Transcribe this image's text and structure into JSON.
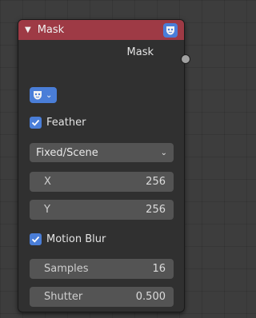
{
  "node": {
    "title": "Mask",
    "header_color": "#9e3a45",
    "header_icon": "mask-icon",
    "output": {
      "label": "Mask"
    },
    "mask_selector": {
      "icon": "mask-icon"
    },
    "feather": {
      "label": "Feather",
      "checked": true
    },
    "size_mode": {
      "value": "Fixed/Scene"
    },
    "x": {
      "label": "X",
      "value": "256"
    },
    "y": {
      "label": "Y",
      "value": "256"
    },
    "motion_blur": {
      "label": "Motion Blur",
      "checked": true
    },
    "samples": {
      "label": "Samples",
      "value": "16"
    },
    "shutter": {
      "label": "Shutter",
      "value": "0.500"
    }
  },
  "colors": {
    "accent": "#4a7ed8",
    "field_bg": "#545454",
    "node_bg": "#303030"
  }
}
